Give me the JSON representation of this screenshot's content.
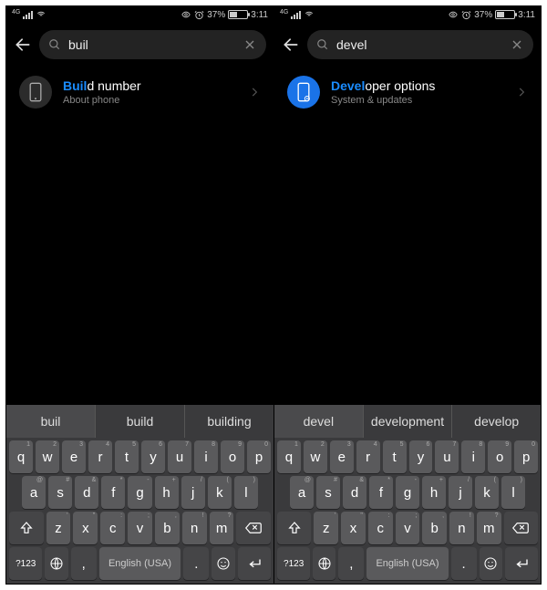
{
  "status": {
    "network_label": "4G",
    "battery_pct": "37%",
    "time": "3:11"
  },
  "screens": [
    {
      "search_query": "buil",
      "result": {
        "title_highlight": "Buil",
        "title_rest": "d number",
        "subtitle": "About phone",
        "icon_blue": false
      },
      "suggestions": [
        "buil",
        "build",
        "building"
      ]
    },
    {
      "search_query": "devel",
      "result": {
        "title_highlight": "Devel",
        "title_rest": "oper options",
        "subtitle": "System & updates",
        "icon_blue": true
      },
      "suggestions": [
        "devel",
        "development",
        "develop"
      ]
    }
  ],
  "keyboard": {
    "row1": [
      "q",
      "w",
      "e",
      "r",
      "t",
      "y",
      "u",
      "i",
      "o",
      "p"
    ],
    "row1_hints": [
      "1",
      "2",
      "3",
      "4",
      "5",
      "6",
      "7",
      "8",
      "9",
      "0"
    ],
    "row2": [
      "a",
      "s",
      "d",
      "f",
      "g",
      "h",
      "j",
      "k",
      "l"
    ],
    "row2_hints": [
      "@",
      "#",
      "&",
      "*",
      "-",
      "+",
      "/",
      "(",
      ")"
    ],
    "row3": [
      "z",
      "x",
      "c",
      "v",
      "b",
      "n",
      "m"
    ],
    "row3_hints": [
      "'",
      "\"",
      ":",
      ";",
      ",",
      "!",
      "?"
    ],
    "symbols_label": "?123",
    "space_label": "English (USA)",
    "comma": ",",
    "period": "."
  }
}
